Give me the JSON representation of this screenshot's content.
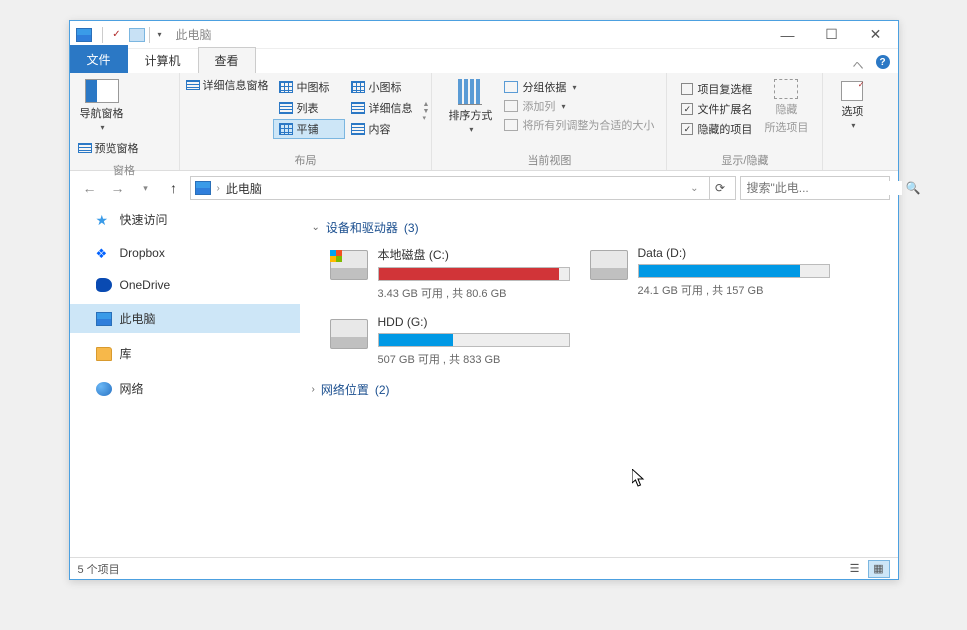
{
  "titlebar": {
    "title": "此电脑"
  },
  "sysbtns": {
    "min": "—",
    "max": "☐",
    "close": "✕"
  },
  "menutabs": {
    "file": "文件",
    "computer": "计算机",
    "view": "查看"
  },
  "ribbon": {
    "panes": {
      "nav_label": "导航窗格",
      "preview": "预览窗格",
      "group": "窗格"
    },
    "layout": {
      "medium_icons": "中图标",
      "small_icons": "小图标",
      "list": "列表",
      "details": "详细信息",
      "tiles": "平铺",
      "content": "内容",
      "details_pane": "详细信息窗格",
      "group": "布局"
    },
    "view": {
      "sort": "排序方式",
      "group_by": "分组依据",
      "add_columns": "添加列",
      "fit_columns": "将所有列调整为合适的大小",
      "group": "当前视图"
    },
    "showhide": {
      "item_checkboxes": "项目复选框",
      "file_extensions": "文件扩展名",
      "hidden_items": "隐藏的项目",
      "hide": "隐藏",
      "hide_selected": "所选项目",
      "group": "显示/隐藏"
    },
    "options": {
      "label": "选项"
    }
  },
  "addr": {
    "text": "此电脑"
  },
  "search": {
    "placeholder": "搜索\"此电..."
  },
  "sidebar": {
    "quick": "快速访问",
    "dropbox": "Dropbox",
    "onedrive": "OneDrive",
    "thispc": "此电脑",
    "libraries": "库",
    "network": "网络"
  },
  "content": {
    "devices_label": "设备和驱动器",
    "devices_count": "(3)",
    "network_label": "网络位置",
    "network_count": "(2)",
    "drives": [
      {
        "name": "本地磁盘 (C:)",
        "free": "3.43 GB",
        "total": "80.6 GB",
        "pct": 95,
        "color": "red",
        "ico": "c"
      },
      {
        "name": "Data (D:)",
        "free": "24.1 GB",
        "total": "157 GB",
        "pct": 85,
        "color": "blue",
        "ico": "d"
      },
      {
        "name": "HDD (G:)",
        "free": "507 GB",
        "total": "833 GB",
        "pct": 39,
        "color": "blue",
        "ico": "d"
      }
    ],
    "free_label": "可用 , 共"
  },
  "status": {
    "count": "5 个项目"
  }
}
